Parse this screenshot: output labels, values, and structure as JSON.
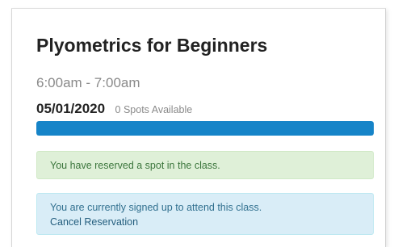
{
  "class": {
    "title": "Plyometrics for Beginners",
    "time": "6:00am - 7:00am",
    "date": "05/01/2020",
    "spots": "0 Spots Available",
    "capacity_filled_percent": 100
  },
  "alerts": {
    "success": "You have reserved a spot in the class.",
    "info_message": "You are currently signed up to attend this class.",
    "cancel_label": "Cancel Reservation"
  },
  "colors": {
    "progress": "#1684c8",
    "success_bg": "#dff0d8",
    "success_text": "#3c763d",
    "info_bg": "#d9edf7",
    "info_text": "#31708f"
  }
}
